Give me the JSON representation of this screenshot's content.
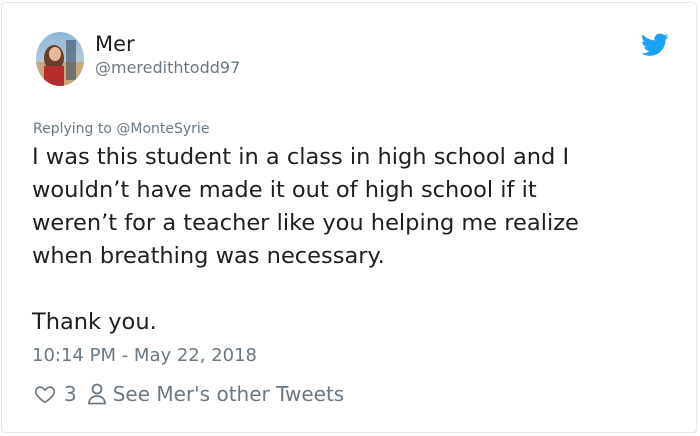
{
  "tweet": {
    "author_name": "Mer",
    "author_handle": "@meredithtodd97",
    "replying_to": "Replying to @MonteSyrie",
    "body": "I was this student in a class in high school and I\nwouldn’t have made it out of high school if it\nweren’t for a teacher like you helping me realize\nwhen breathing was necessary.",
    "closing": "Thank you.",
    "timestamp": "10:14 PM - May 22, 2018",
    "like_count": "3",
    "other_tweets_label": "See Mer's other Tweets"
  },
  "icons": {
    "brand": "twitter-bird-icon",
    "like": "heart-icon",
    "profile": "person-icon"
  },
  "colors": {
    "twitter_blue": "#1da1f2",
    "text_primary": "#1c2022",
    "text_secondary": "#697882",
    "border": "#e1e8ed"
  }
}
